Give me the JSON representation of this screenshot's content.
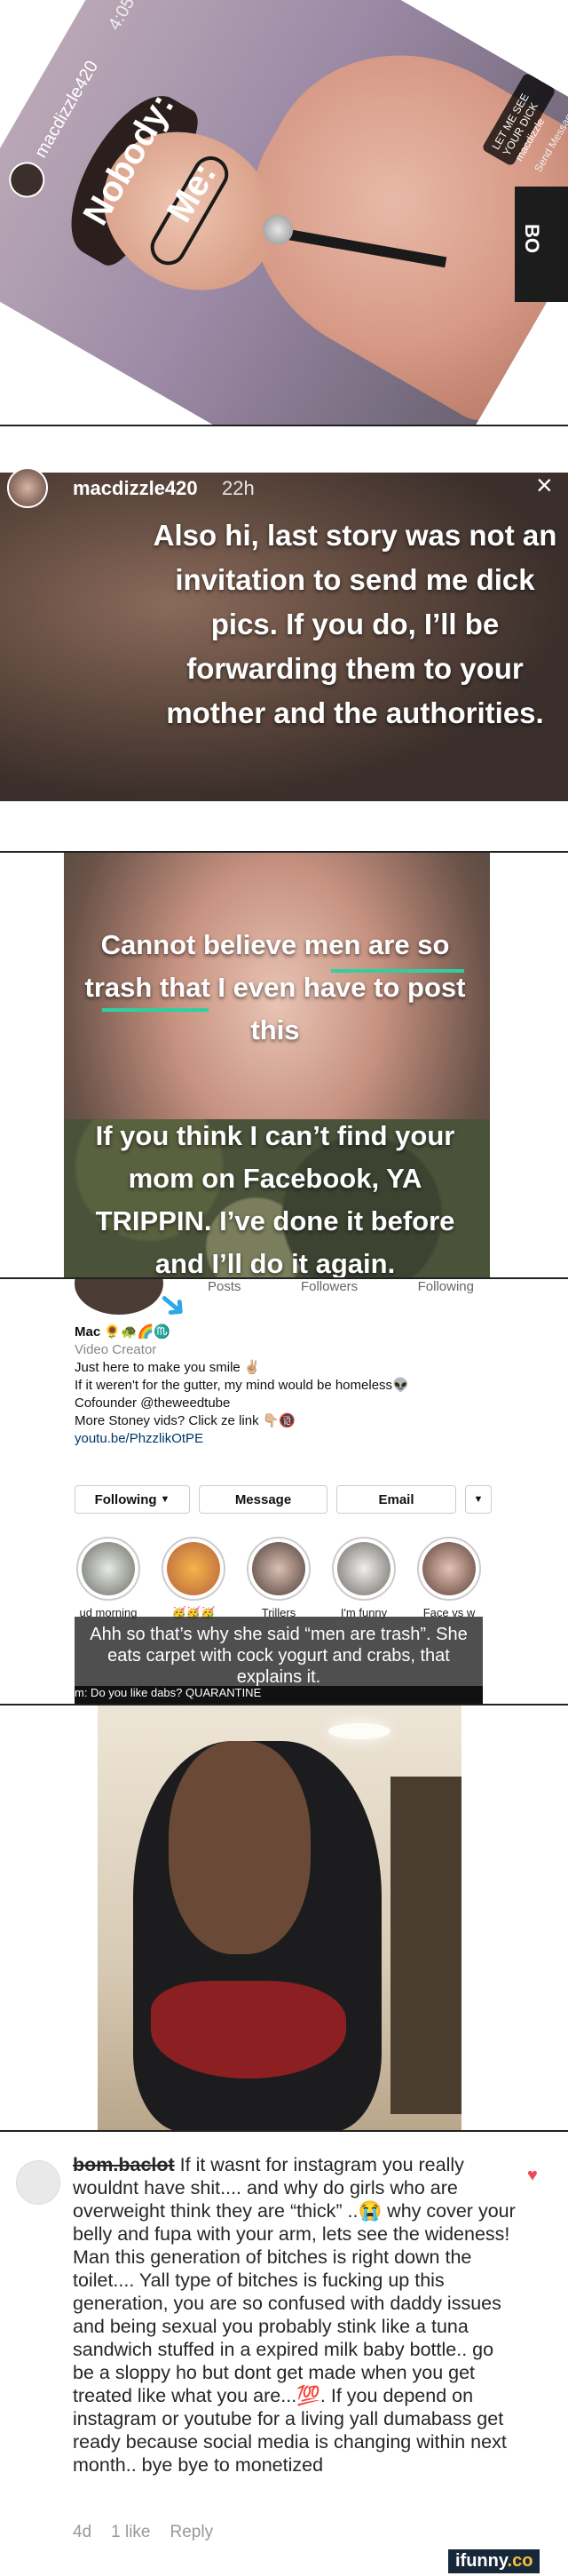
{
  "panel1": {
    "username": "macdizzle420",
    "time": "4:05",
    "caption_nobody": "Nobody:",
    "caption_me": "Me:",
    "sticker_text": "LET ME SEE YOUR DICK",
    "sticker_handle": "macdizzle",
    "send_message": "Send Message",
    "side_text": "BO"
  },
  "panel2": {
    "username": "macdizzle420",
    "time": "22h",
    "close": "×",
    "text": "Also hi, last story was not an invitation to send me dick pics. If you do, I’ll be forwarding them to your mother and the authorities."
  },
  "panel3": {
    "text_top": "Cannot believe men are so trash that I even have to post this",
    "text_bottom": "If you think I can’t find your mom on Facebook, YA TRIPPIN. I’ve done it before and I’ll do it again."
  },
  "panel4": {
    "stats": [
      "Posts",
      "Followers",
      "Following"
    ],
    "display_name": "Mac 🌻🐢🌈♏",
    "category": "Video Creator",
    "bio_lines": [
      "Just here to make you smile ✌🏼",
      "If it weren't for the gutter, my mind would be homeless👽",
      "Cofounder @theweedtube",
      "More Stoney vids? Click ze link 👇🏼🔞",
      "youtu.be/PhzzlikOtPE"
    ],
    "buttons": [
      "Following",
      "Message",
      "Email"
    ],
    "highlights": [
      "ud morning",
      "🥳🥳🥳",
      "Trillers",
      "I'm funny",
      "Face vs w"
    ],
    "caption": "Ahh so that’s why she said “men are trash”. She eats carpet with cock yogurt and crabs, that explains it.",
    "bottom_bar": "m: Do you like dabs?   QUARANTINE"
  },
  "panel6": {
    "comment_name": "bom.baclot",
    "comment_text": " If it wasnt for instagram you really wouldnt have shit.... and why do girls who are overweight think they are “thick” ..😭 why cover your belly and fupa with your arm, lets see the wideness! Man this generation of bitches is right down the toilet.... Yall type of bitches is fucking up this generation, you are so confused with daddy issues and being sexual you probably stink like a tuna sandwich stuffed in a expired milk baby bottle.. go be a sloppy ho but dont get made when you get treated like what you are...💯. If you depend on instagram or youtube for a living yall dumabass get ready because social media is changing within next month.. bye bye to monetized",
    "age": "4d",
    "likes": "1 like",
    "reply": "Reply",
    "brand_main": "ifunny",
    "brand_dot": ".co"
  }
}
